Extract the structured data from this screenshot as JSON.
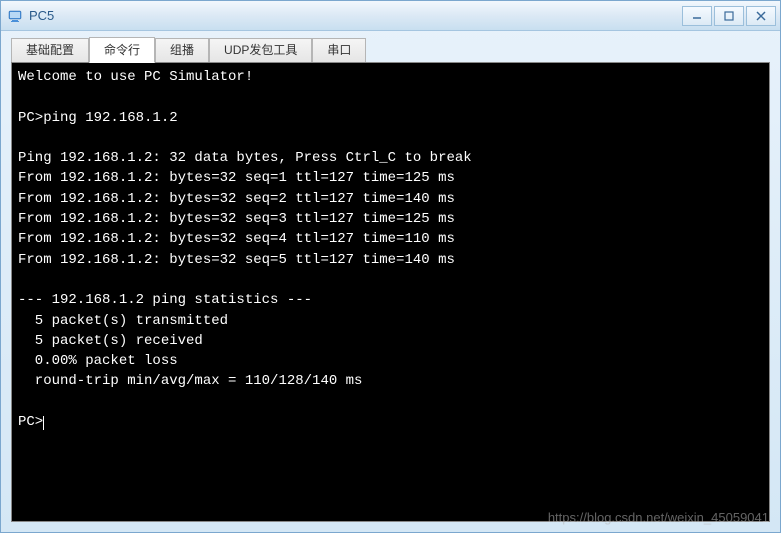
{
  "window": {
    "title": "PC5"
  },
  "tabs": [
    {
      "label": "基础配置",
      "active": false
    },
    {
      "label": "命令行",
      "active": true
    },
    {
      "label": "组播",
      "active": false
    },
    {
      "label": "UDP发包工具",
      "active": false
    },
    {
      "label": "串口",
      "active": false
    }
  ],
  "terminal": {
    "lines": [
      "Welcome to use PC Simulator!",
      "",
      "PC>ping 192.168.1.2",
      "",
      "Ping 192.168.1.2: 32 data bytes, Press Ctrl_C to break",
      "From 192.168.1.2: bytes=32 seq=1 ttl=127 time=125 ms",
      "From 192.168.1.2: bytes=32 seq=2 ttl=127 time=140 ms",
      "From 192.168.1.2: bytes=32 seq=3 ttl=127 time=125 ms",
      "From 192.168.1.2: bytes=32 seq=4 ttl=127 time=110 ms",
      "From 192.168.1.2: bytes=32 seq=5 ttl=127 time=140 ms",
      "",
      "--- 192.168.1.2 ping statistics ---",
      "  5 packet(s) transmitted",
      "  5 packet(s) received",
      "  0.00% packet loss",
      "  round-trip min/avg/max = 110/128/140 ms",
      "",
      "PC>"
    ]
  },
  "watermark": "https://blog.csdn.net/weixin_45059041"
}
